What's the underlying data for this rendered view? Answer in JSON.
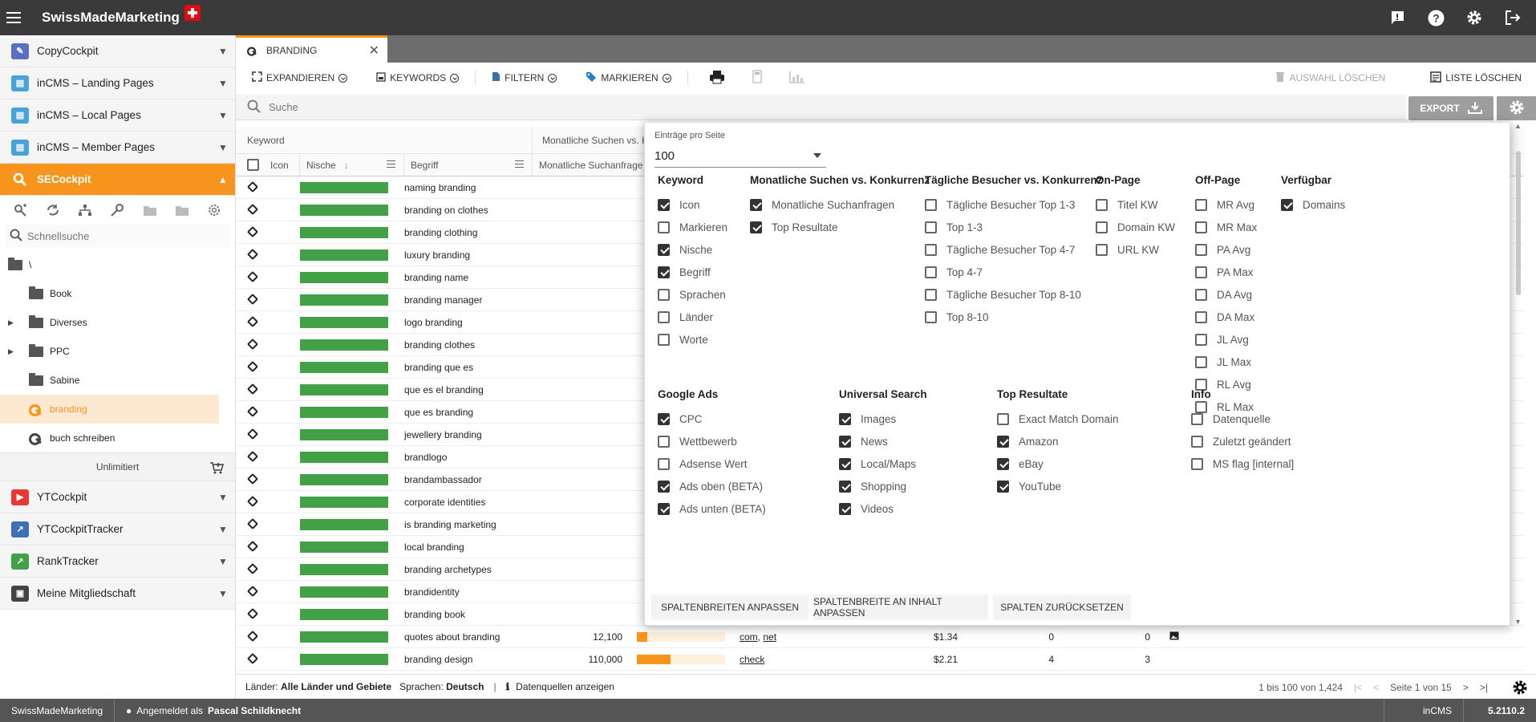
{
  "app": {
    "brand": "SwissMadeMarketing"
  },
  "sidebar": {
    "modules": [
      {
        "label": "CopyCockpit",
        "color": "#5b6fc1"
      },
      {
        "label": "inCMS – Landing Pages",
        "color": "#4aa3d8"
      },
      {
        "label": "inCMS – Local Pages",
        "color": "#4aa3d8"
      },
      {
        "label": "inCMS – Member Pages",
        "color": "#4aa3d8"
      },
      {
        "label": "SECockpit",
        "color": "#f7941d"
      }
    ],
    "quicksearch_placeholder": "Schnellsuche",
    "tree": [
      {
        "label": "\\"
      },
      {
        "label": "Book"
      },
      {
        "label": "Diverses"
      },
      {
        "label": "PPC"
      },
      {
        "label": "Sabine"
      },
      {
        "label": "branding"
      },
      {
        "label": "buch schreiben"
      }
    ],
    "unlimited": "Unlimitiert",
    "modules2": [
      {
        "label": "YTCockpit",
        "color": "#e53935"
      },
      {
        "label": "YTCockpitTracker",
        "color": "#3f6fb5"
      },
      {
        "label": "RankTracker",
        "color": "#43a047"
      },
      {
        "label": "Meine Mitgliedschaft",
        "color": "#444444"
      }
    ]
  },
  "tab": {
    "label": "BRANDING"
  },
  "toolbar": {
    "expand": "EXPANDIEREN",
    "keywords": "KEYWORDS",
    "filter": "FILTERN",
    "mark": "MARKIEREN",
    "clear_selection": "AUSWAHL LÖSCHEN",
    "clear_list": "LISTE LÖSCHEN"
  },
  "search": {
    "placeholder": "Suche"
  },
  "export": {
    "label": "EXPORT"
  },
  "table": {
    "group_headers": [
      "Keyword",
      "Monatliche Suchen vs. K"
    ],
    "col_headers": [
      "Icon",
      "Nische",
      "Begriff",
      "Monatliche Suchanfrage"
    ],
    "rows": [
      {
        "term": "naming branding"
      },
      {
        "term": "branding on clothes"
      },
      {
        "term": "branding clothing"
      },
      {
        "term": "luxury branding"
      },
      {
        "term": "branding name"
      },
      {
        "term": "branding manager"
      },
      {
        "term": "logo branding"
      },
      {
        "term": "branding clothes"
      },
      {
        "term": "branding que es"
      },
      {
        "term": "que es el branding"
      },
      {
        "term": "que es branding"
      },
      {
        "term": "jewellery branding"
      },
      {
        "term": "brandlogo"
      },
      {
        "term": "brandambassador"
      },
      {
        "term": "corporate identities"
      },
      {
        "term": "is branding marketing"
      },
      {
        "term": "local branding"
      },
      {
        "term": "branding archetypes"
      },
      {
        "term": "brandidentity"
      },
      {
        "term": "branding book"
      },
      {
        "term": "quotes about branding",
        "search": "12,100",
        "comp": 0.12,
        "domains": [
          "com",
          "net"
        ],
        "cpc": "$1.34",
        "n1": "0",
        "n2": "0",
        "img": true
      },
      {
        "term": "branding design",
        "search": "110,000",
        "comp": 0.38,
        "domains": [
          "check"
        ],
        "cpc": "$2.21",
        "n1": "4",
        "n2": "3",
        "img": false
      }
    ]
  },
  "popup": {
    "entries_label": "Einträge pro Seite",
    "entries_value": "100",
    "groups": [
      {
        "title": "Keyword",
        "options": [
          {
            "label": "Icon",
            "on": true
          },
          {
            "label": "Markieren",
            "on": false
          },
          {
            "label": "Nische",
            "on": true
          },
          {
            "label": "Begriff",
            "on": true
          },
          {
            "label": "Sprachen",
            "on": false
          },
          {
            "label": "Länder",
            "on": false
          },
          {
            "label": "Worte",
            "on": false
          }
        ]
      },
      {
        "title": "Monatliche Suchen vs. Konkurrenz",
        "options": [
          {
            "label": "Monatliche Suchanfragen",
            "on": true
          },
          {
            "label": "Top Resultate",
            "on": true
          }
        ]
      },
      {
        "title": "Tägliche Besucher vs. Konkurrenz",
        "options": [
          {
            "label": "Tägliche Besucher Top 1-3",
            "on": false
          },
          {
            "label": "Top 1-3",
            "on": false
          },
          {
            "label": "Tägliche Besucher Top 4-7",
            "on": false
          },
          {
            "label": "Top 4-7",
            "on": false
          },
          {
            "label": "Tägliche Besucher Top 8-10",
            "on": false
          },
          {
            "label": "Top 8-10",
            "on": false
          }
        ]
      },
      {
        "title": "On-Page",
        "options": [
          {
            "label": "Titel KW",
            "on": false
          },
          {
            "label": "Domain KW",
            "on": false
          },
          {
            "label": "URL KW",
            "on": false
          }
        ]
      },
      {
        "title": "Off-Page",
        "options": [
          {
            "label": "MR Avg",
            "on": false
          },
          {
            "label": "MR Max",
            "on": false
          },
          {
            "label": "PA Avg",
            "on": false
          },
          {
            "label": "PA Max",
            "on": false
          },
          {
            "label": "DA Avg",
            "on": false
          },
          {
            "label": "DA Max",
            "on": false
          },
          {
            "label": "JL Avg",
            "on": false
          },
          {
            "label": "JL Max",
            "on": false
          },
          {
            "label": "RL Avg",
            "on": false
          },
          {
            "label": "RL Max",
            "on": false
          }
        ]
      },
      {
        "title": "Verfügbar",
        "options": [
          {
            "label": "Domains",
            "on": true
          }
        ]
      },
      {
        "title": "Google Ads",
        "options": [
          {
            "label": "CPC",
            "on": true
          },
          {
            "label": "Wettbewerb",
            "on": false
          },
          {
            "label": "Adsense Wert",
            "on": false
          },
          {
            "label": "Ads oben (BETA)",
            "on": true
          },
          {
            "label": "Ads unten (BETA)",
            "on": true
          }
        ]
      },
      {
        "title": "Universal Search",
        "options": [
          {
            "label": "Images",
            "on": true
          },
          {
            "label": "News",
            "on": true
          },
          {
            "label": "Local/Maps",
            "on": true
          },
          {
            "label": "Shopping",
            "on": true
          },
          {
            "label": "Videos",
            "on": true
          }
        ]
      },
      {
        "title": "Top Resultate",
        "options": [
          {
            "label": "Exact Match Domain",
            "on": false
          },
          {
            "label": "Amazon",
            "on": true
          },
          {
            "label": "eBay",
            "on": true
          },
          {
            "label": "YouTube",
            "on": true
          }
        ]
      },
      {
        "title": "Info",
        "options": [
          {
            "label": "Datenquelle",
            "on": false
          },
          {
            "label": "Zuletzt geändert",
            "on": false
          },
          {
            "label": "MS flag [internal]",
            "on": false
          }
        ]
      }
    ],
    "buttons": [
      "SPALTENBREITEN ANPASSEN",
      "SPALTENBREITE AN INHALT ANPASSEN",
      "SPALTEN ZURÜCKSETZEN"
    ]
  },
  "footer": {
    "countries_label": "Länder:",
    "countries_value": "Alle Länder und Gebiete",
    "languages_label": "Sprachen:",
    "languages_value": "Deutsch",
    "sources": "Datenquellen anzeigen",
    "range": "1 bis 100 von 1,424",
    "page": "Seite 1 von 15"
  },
  "statusbar": {
    "brand": "SwissMadeMarketing",
    "logged_in": "Angemeldet als",
    "user": "Pascal Schildknecht",
    "product": "inCMS",
    "version": "5.2110.2"
  }
}
